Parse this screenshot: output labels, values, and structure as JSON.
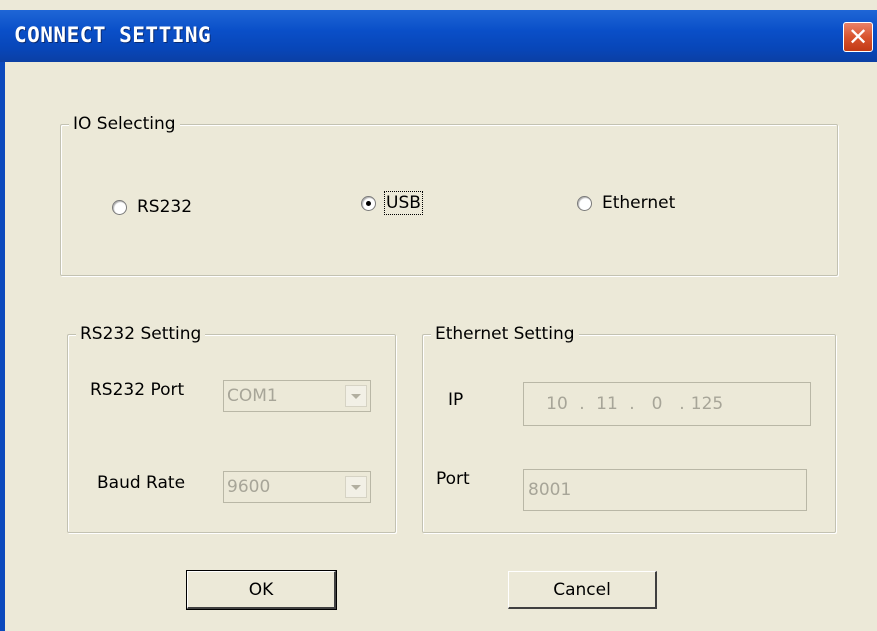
{
  "window": {
    "title": "CONNECT SETTING",
    "close_glyph": "✕"
  },
  "io_selecting": {
    "legend": "IO Selecting",
    "options": [
      {
        "label": "RS232",
        "checked": false
      },
      {
        "label": "USB",
        "checked": true
      },
      {
        "label": "Ethernet",
        "checked": false
      }
    ]
  },
  "rs232_setting": {
    "legend": "RS232 Setting",
    "port_label": "RS232 Port",
    "port_value": "COM1",
    "baud_label": "Baud Rate",
    "baud_value": "9600"
  },
  "ethernet_setting": {
    "legend": "Ethernet Setting",
    "ip_label": "IP",
    "ip_octets": [
      "10",
      "11",
      "0",
      "125"
    ],
    "ip_separator": ".",
    "port_label": "Port",
    "port_value": "8001"
  },
  "buttons": {
    "ok": "OK",
    "cancel": "Cancel"
  },
  "colors": {
    "titlebar": "#0a4fc8",
    "dialog_bg": "#ece9d8",
    "disabled_text": "#a7a598",
    "close_button": "#d9542e"
  },
  "icons": {
    "close": "close-icon",
    "dropdown": "chevron-down-icon"
  }
}
